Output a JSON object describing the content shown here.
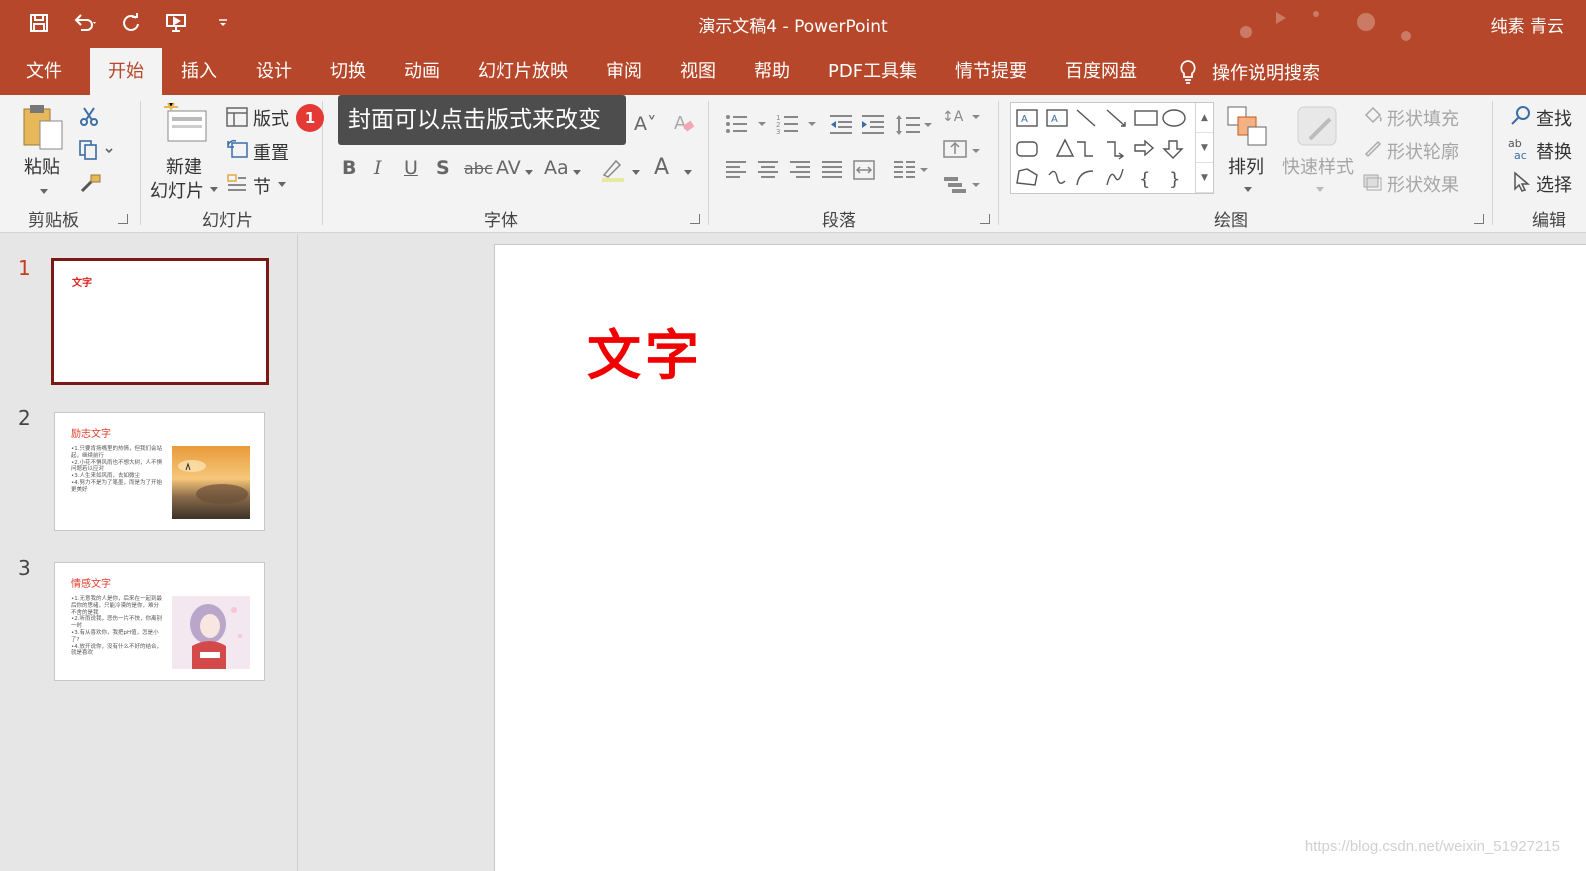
{
  "titlebar": {
    "doc_title": "演示文稿4  -  PowerPoint",
    "user_name": "纯素 青云",
    "bg_color": "#b7472a"
  },
  "tabs": [
    {
      "label": "文件"
    },
    {
      "label": "开始"
    },
    {
      "label": "插入"
    },
    {
      "label": "设计"
    },
    {
      "label": "切换"
    },
    {
      "label": "动画"
    },
    {
      "label": "幻灯片放映"
    },
    {
      "label": "审阅"
    },
    {
      "label": "视图"
    },
    {
      "label": "帮助"
    },
    {
      "label": "PDF工具集"
    },
    {
      "label": "情节提要"
    },
    {
      "label": "百度网盘"
    }
  ],
  "active_tab": "开始",
  "tellme": {
    "label": "操作说明搜索",
    "icon": "lightbulb-icon"
  },
  "ribbon": {
    "clipboard": {
      "label": "剪贴板",
      "paste": "粘贴"
    },
    "slides": {
      "label": "幻灯片",
      "new_slide_line1": "新建",
      "new_slide_line2": "幻灯片",
      "layout": "版式",
      "reset": "重置",
      "section": "节"
    },
    "font": {
      "label": "字体"
    },
    "paragraph": {
      "label": "段落"
    },
    "drawing": {
      "label": "绘图",
      "arrange": "排列",
      "quick_styles": "快速样式",
      "shape_fill": "形状填充",
      "shape_outline": "形状轮廓",
      "shape_effects": "形状效果"
    },
    "editing": {
      "label": "编辑",
      "find": "查找",
      "replace": "替换",
      "select": "选择"
    }
  },
  "annotation": {
    "badge": "1",
    "tooltip": "封面可以点击版式来改变"
  },
  "slides": [
    {
      "number": "1",
      "title": "文字",
      "active": true,
      "bullets": []
    },
    {
      "number": "2",
      "title": "励志文字",
      "active": false,
      "bullets": [
        "•1.只要肯扬嘴里的热情，但我们会站起，继续前行",
        "•2.小花不惧风雨也不想大树，人不惧问题若以应对",
        "•3.人生来如风雨，去如微尘",
        "•4.努力不是为了笔墨，而是为了开始更美好"
      ]
    },
    {
      "number": "3",
      "title": "情感文字",
      "active": false,
      "bullets": [
        "•1.无意我的人是你，后来在一起到最后你的思绪，只能冷漠的是你，难分不舍的是我",
        "•2.听雨说我，悲伤一片不快，你离别一时",
        "•3.有从喜欢你，我把pH值，怎是小了?",
        "•4.放开说你，没有什么不好的结合，就是喜欢"
      ]
    }
  ],
  "current_slide": {
    "title": "文字",
    "title_color": "#f00000"
  },
  "watermark": "https://blog.csdn.net/weixin_51927215"
}
